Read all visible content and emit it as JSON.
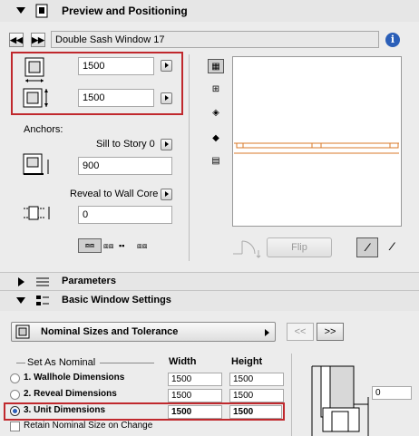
{
  "preview": {
    "title": "Preview and Positioning",
    "object_name": "Double Sash Window 17",
    "width_value": "1500",
    "height_value": "1500",
    "anchors_label": "Anchors:",
    "sill_label": "Sill to Story 0",
    "sill_value": "900",
    "reveal_label": "Reveal to Wall Core",
    "reveal_value": "0",
    "flip_label": "Flip"
  },
  "parameters": {
    "title": "Parameters"
  },
  "basic": {
    "title": "Basic Window Settings",
    "dropdown_value": "Nominal Sizes and Tolerance",
    "prev_label": "<<",
    "next_label": ">>",
    "set_as_nominal": "Set As Nominal",
    "width_header": "Width",
    "height_header": "Height",
    "rows": [
      {
        "label": "1. Wallhole Dimensions",
        "width": "1500",
        "height": "1500",
        "selected": false
      },
      {
        "label": "2. Reveal Dimensions",
        "width": "1500",
        "height": "1500",
        "selected": false
      },
      {
        "label": "3. Unit Dimensions",
        "width": "1500",
        "height": "1500",
        "selected": true
      }
    ],
    "retain_label": "Retain Nominal Size on Change",
    "side_value": "0"
  }
}
